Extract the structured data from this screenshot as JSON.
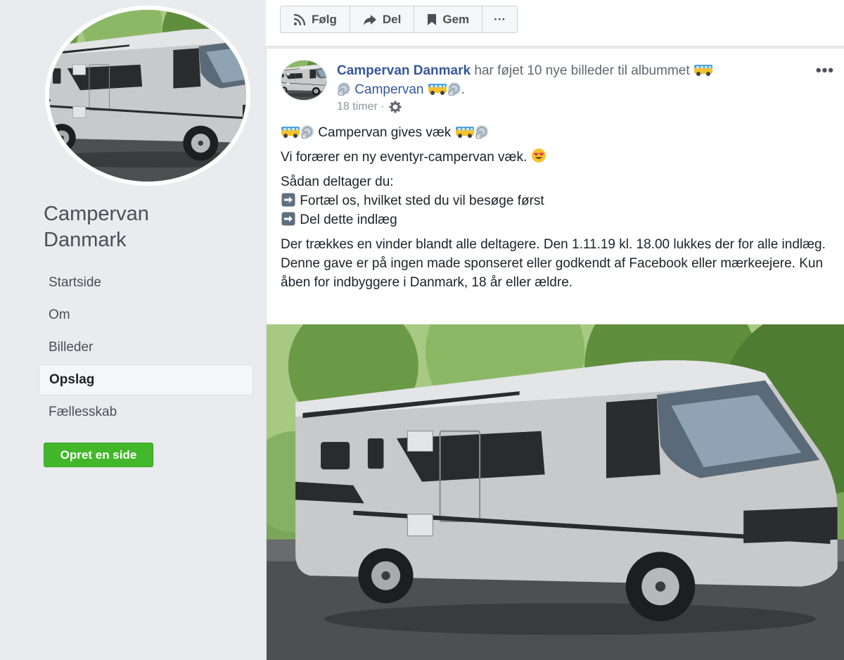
{
  "page": {
    "name_line1": "Campervan",
    "name_line2": "Danmark"
  },
  "nav": {
    "items": [
      {
        "label": "Startside"
      },
      {
        "label": "Om"
      },
      {
        "label": "Billeder"
      },
      {
        "label": "Opslag",
        "active": true
      },
      {
        "label": "Fællesskab"
      }
    ]
  },
  "create_page_button": "Opret en side",
  "actions": {
    "follow": "Følg",
    "share": "Del",
    "save": "Gem",
    "more": "···"
  },
  "post": {
    "author": "Campervan Danmark",
    "action_text": " har føjet 10 nye billeder til albummet ",
    "album_name": " Campervan ",
    "timestamp": "18 timer",
    "more": "•••",
    "title": " Campervan gives væk ",
    "line1": "Vi forærer en ny eventyr-campervan væk. ",
    "how_to": "Sådan deltager du:",
    "step1": " Fortæl os, hvilket sted du vil besøge først",
    "step2": " Del dette indlæg",
    "terms": "Der trækkes en vinder blandt alle deltagere. Den 1.11.19 kl. 18.00 lukkes der for alle indlæg. Denne gave er på ingen made sponseret eller godkendt af Facebook eller mærkeejere. Kun åben for indbyggere i Danmark, 18 år eller ældre."
  },
  "icons": {
    "follow": "rss-icon",
    "share": "share-arrow-icon",
    "save": "bookmark-icon",
    "privacy": "gear-icon",
    "van": "minibus-emoji",
    "dizzy": "dizzy-emoji",
    "heart_eyes": "heart-eyes-emoji",
    "arrow": "right-arrow-emoji"
  },
  "colors": {
    "link": "#365899",
    "create_button": "#42b72a",
    "background": "#e9ebee"
  }
}
